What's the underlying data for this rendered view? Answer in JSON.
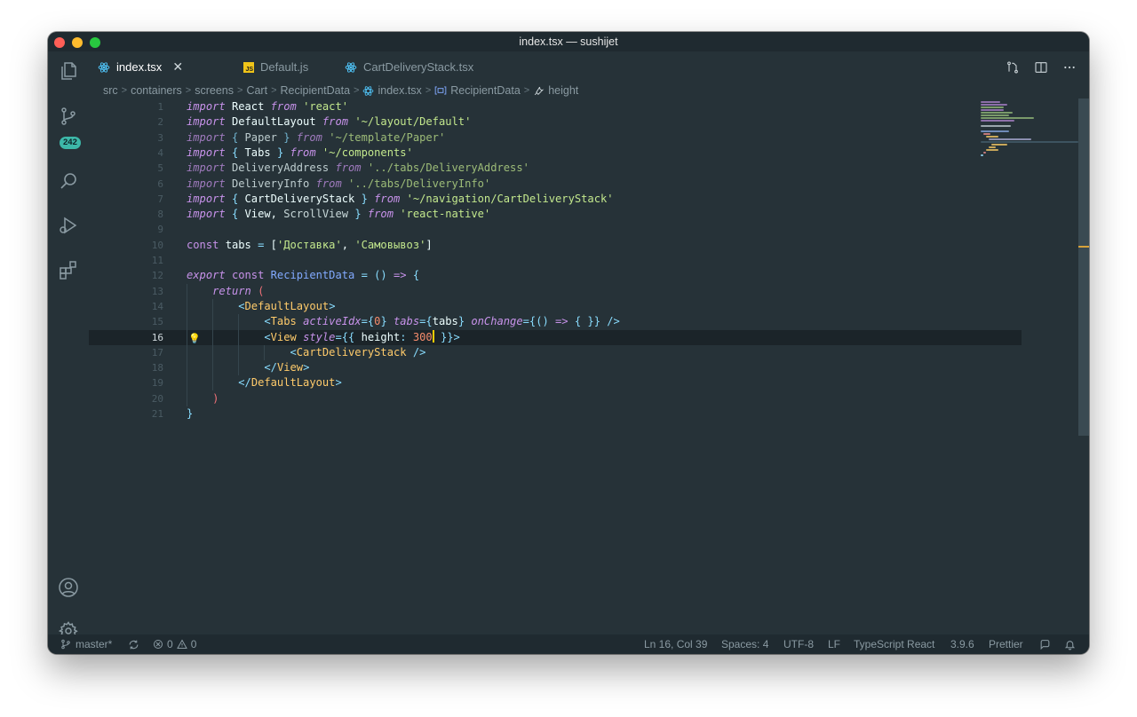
{
  "window": {
    "title": "index.tsx — sushijet"
  },
  "activity_bar": {
    "scm_badge": "242"
  },
  "tabs": [
    {
      "label": "index.tsx",
      "icon": "react-icon",
      "active": true
    },
    {
      "label": "Default.js",
      "icon": "js-icon",
      "active": false
    },
    {
      "label": "CartDeliveryStack.tsx",
      "icon": "react-icon",
      "active": false
    }
  ],
  "breadcrumb": [
    "src",
    "containers",
    "screens",
    "Cart",
    "RecipientData",
    "index.tsx",
    "RecipientData",
    "height"
  ],
  "code": {
    "line_numbers": [
      "1",
      "2",
      "3",
      "4",
      "5",
      "6",
      "7",
      "8",
      "9",
      "10",
      "11",
      "12",
      "13",
      "14",
      "15",
      "16",
      "17",
      "18",
      "19",
      "20",
      "21"
    ],
    "current_line": 16,
    "tokens": {
      "l1": [
        "import",
        "React",
        "from",
        "'react'"
      ],
      "l2": [
        "import",
        "DefaultLayout",
        "from",
        "'~/layout/Default'"
      ],
      "l3": [
        "import",
        "{",
        "Paper",
        "}",
        "from",
        "'~/template/Paper'"
      ],
      "l4": [
        "import",
        "{",
        "Tabs",
        "}",
        "from",
        "'~/components'"
      ],
      "l5": [
        "import",
        "DeliveryAddress",
        "from",
        "'../tabs/DeliveryAddress'"
      ],
      "l6": [
        "import",
        "DeliveryInfo",
        "from",
        "'../tabs/DeliveryInfo'"
      ],
      "l7": [
        "import",
        "{",
        "CartDeliveryStack",
        "}",
        "from",
        "'~/navigation/CartDeliveryStack'"
      ],
      "l8": [
        "import",
        "{",
        "View,",
        "ScrollView",
        "}",
        "from",
        "'react-native'"
      ],
      "l10": [
        "const",
        "tabs",
        "=",
        "[",
        "'Доставка'",
        ",",
        "'Самовывоз'",
        "]"
      ],
      "l12": [
        "export",
        "const",
        "RecipientData",
        "=",
        "()",
        "=>",
        "{"
      ],
      "l13": [
        "return",
        "("
      ],
      "l14": [
        "<",
        "DefaultLayout",
        ">"
      ],
      "l15": [
        "<",
        "Tabs",
        "activeIdx",
        "={",
        "0",
        "}",
        "tabs",
        "={",
        "tabs",
        "}",
        "onChange",
        "={",
        "()",
        "=>",
        "{ }",
        "}",
        "/>"
      ],
      "l16": [
        "<",
        "View",
        "style",
        "={{",
        "height",
        ":",
        "300",
        "}}>"
      ],
      "l17": [
        "<",
        "CartDeliveryStack",
        "/>"
      ],
      "l18": [
        "</",
        "View",
        ">"
      ],
      "l19": [
        "</",
        "DefaultLayout",
        ">"
      ],
      "l20": [
        ")"
      ],
      "l21": [
        "}"
      ]
    }
  },
  "status_bar": {
    "branch": "master*",
    "errors": "0",
    "warnings": "0",
    "position": "Ln 16, Col 39",
    "spaces": "Spaces: 4",
    "encoding": "UTF-8",
    "eol": "LF",
    "language": "TypeScript React",
    "version": "3.9.6",
    "formatter": "Prettier"
  },
  "colors": {
    "editor_bg": "#263238",
    "keyword": "#c792ea",
    "string": "#c3e88d",
    "tag": "#f07178",
    "component": "#ffcb6b",
    "punctuation": "#89ddff",
    "number": "#f78c6c",
    "badge": "#3db8a9"
  }
}
